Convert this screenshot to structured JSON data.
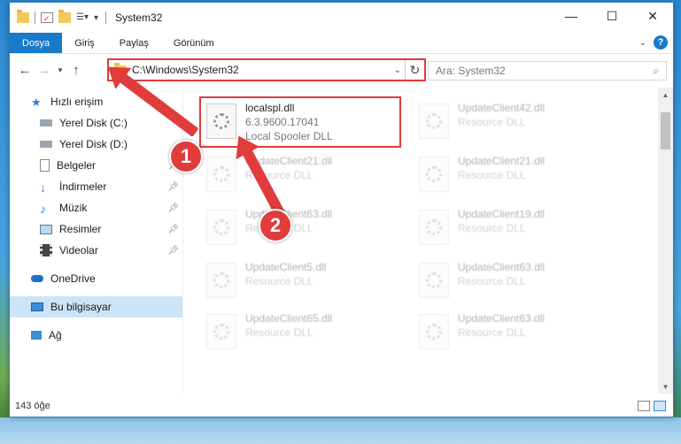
{
  "window": {
    "title": "System32"
  },
  "ribbon": {
    "tabs": [
      "Dosya",
      "Giriş",
      "Paylaş",
      "Görünüm"
    ],
    "help": "?"
  },
  "address": {
    "path": "C:\\Windows\\System32",
    "search_placeholder": "Ara: System32"
  },
  "sidebar": {
    "quick_access": "Hızlı erişim",
    "items": [
      {
        "label": "Yerel Disk (C:)",
        "icon": "drive-icon",
        "pinned": false
      },
      {
        "label": "Yerel Disk (D:)",
        "icon": "drive-icon",
        "pinned": false
      },
      {
        "label": "Belgeler",
        "icon": "documents-icon",
        "pinned": true
      },
      {
        "label": "İndirmeler",
        "icon": "downloads-icon",
        "pinned": true
      },
      {
        "label": "Müzik",
        "icon": "music-icon",
        "pinned": true
      },
      {
        "label": "Resimler",
        "icon": "pictures-icon",
        "pinned": true
      },
      {
        "label": "Videolar",
        "icon": "videos-icon",
        "pinned": true
      }
    ],
    "onedrive": "OneDrive",
    "this_pc": "Bu bilgisayar",
    "network": "Ağ"
  },
  "files": {
    "highlighted": {
      "name": "localspl.dll",
      "version": "6.3.9600.17041",
      "description": "Local Spooler DLL"
    },
    "faded": [
      {
        "name": "UpdateClient42.dll",
        "description": "Resource DLL"
      },
      {
        "name": "UpdateClient21.dll",
        "description": "Resource DLL"
      },
      {
        "name": "UpdateClient21.dll",
        "description": "Resource DLL"
      },
      {
        "name": "UpdateClient63.dll",
        "description": "Resource DLL"
      },
      {
        "name": "UpdateClient19.dll",
        "description": "Resource DLL"
      },
      {
        "name": "UpdateClient5.dll",
        "description": "Resource DLL"
      },
      {
        "name": "UpdateClient63.dll",
        "description": "Resource DLL"
      },
      {
        "name": "UpdateClient65.dll",
        "description": "Resource DLL"
      },
      {
        "name": "UpdateClient63.dll",
        "description": "Resource DLL"
      }
    ]
  },
  "status": {
    "count": "143 öğe"
  },
  "callouts": {
    "one": "1",
    "two": "2"
  },
  "colors": {
    "accent": "#1979ca",
    "callout": "#e03c3c",
    "selection": "#cce4f7"
  }
}
